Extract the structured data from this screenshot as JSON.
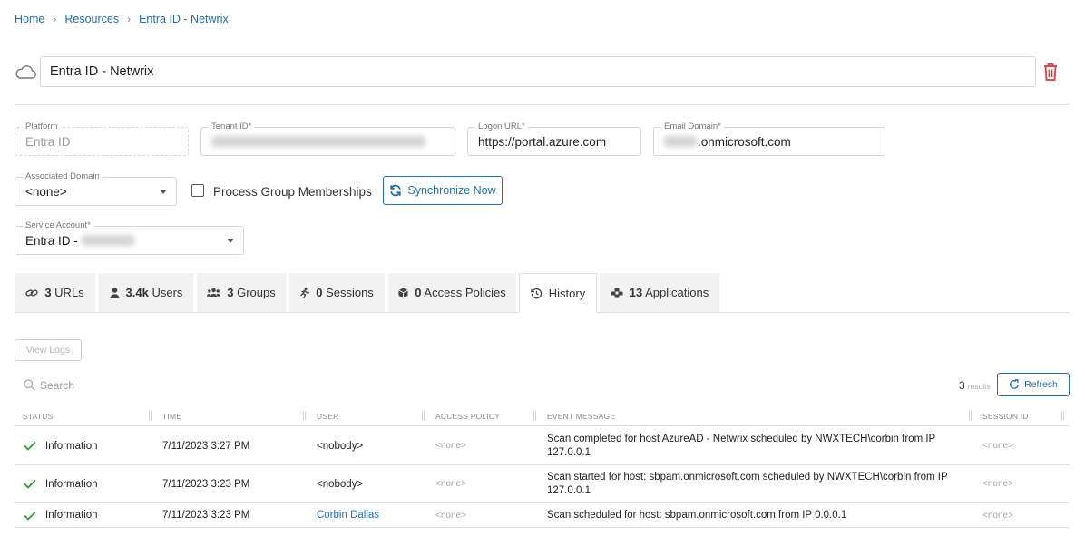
{
  "breadcrumb": {
    "home": "Home",
    "resources": "Resources",
    "current": "Entra ID - Netwrix"
  },
  "title": {
    "value": "Entra ID - Netwrix"
  },
  "fields": {
    "platform": {
      "label": "Platform",
      "value": "Entra ID"
    },
    "tenant_id": {
      "label": "Tenant ID*"
    },
    "logon_url": {
      "label": "Logon URL*",
      "value": "https://portal.azure.com"
    },
    "email_domain": {
      "label": "Email Domain*",
      "suffix": ".onmicrosoft.com"
    },
    "associated_domain": {
      "label": "Associated Domain",
      "value": "<none>"
    },
    "service_account": {
      "label": "Service Account*",
      "prefix": "Entra ID -"
    }
  },
  "process_group_memberships": {
    "label": "Process Group Memberships",
    "checked": false
  },
  "sync_button": {
    "label": "Synchronize Now"
  },
  "tabs": [
    {
      "count": "3",
      "label": "URLs",
      "icon": "link-icon"
    },
    {
      "count": "3.4k",
      "label": "Users",
      "icon": "user-icon"
    },
    {
      "count": "3",
      "label": "Groups",
      "icon": "users-icon"
    },
    {
      "count": "0",
      "label": "Sessions",
      "icon": "running-person-icon"
    },
    {
      "count": "0",
      "label": "Access Policies",
      "icon": "cube-icon"
    },
    {
      "count": "",
      "label": "History",
      "icon": "history-icon",
      "active": true
    },
    {
      "count": "13",
      "label": "Applications",
      "icon": "applications-icon"
    }
  ],
  "view_logs": {
    "label": "View Logs"
  },
  "search": {
    "placeholder": "Search"
  },
  "results": {
    "count": "3",
    "label": "results"
  },
  "refresh": {
    "label": "Refresh"
  },
  "table": {
    "headers": [
      "STATUS",
      "TIME",
      "USER",
      "ACCESS POLICY",
      "EVENT MESSAGE",
      "SESSION ID"
    ],
    "rows": [
      {
        "status": "Information",
        "time": "7/11/2023 3:27 PM",
        "user": "<nobody>",
        "access_policy": "<none>",
        "message": "Scan completed for host AzureAD - Netwrix scheduled by NWXTECH\\corbin from IP 127.0.0.1",
        "session_id": "<none>"
      },
      {
        "status": "Information",
        "time": "7/11/2023 3:23 PM",
        "user": "<nobody>",
        "access_policy": "<none>",
        "message": "Scan started for host: sbpam.onmicrosoft.com scheduled by NWXTECH\\corbin from IP 127.0.0.1",
        "session_id": "<none>"
      },
      {
        "status": "Information",
        "time": "7/11/2023 3:23 PM",
        "user": "Corbin Dallas",
        "access_policy": "<none>",
        "message": "Scan scheduled for host: sbpam.onmicrosoft.com from IP 0.0.0.1",
        "session_id": "<none>"
      }
    ]
  },
  "colors": {
    "accent": "#1f6fb5",
    "success": "#2e9a3e",
    "danger": "#e03a3a"
  }
}
